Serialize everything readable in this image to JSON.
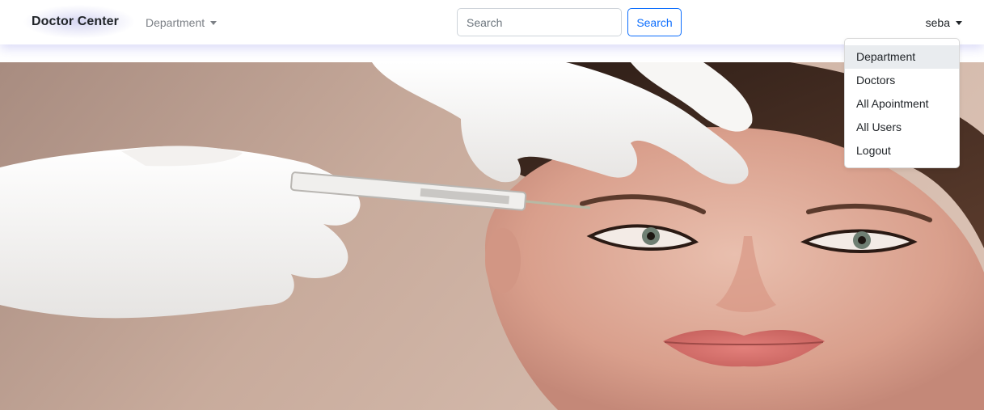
{
  "navbar": {
    "brand": "Doctor Center",
    "department_label": "Department",
    "user_label": "seba"
  },
  "search": {
    "placeholder": "Search",
    "button_label": "Search"
  },
  "user_menu": {
    "items": [
      {
        "label": "Department"
      },
      {
        "label": "Doctors"
      },
      {
        "label": "All Apointment"
      },
      {
        "label": "All Users"
      },
      {
        "label": "Logout"
      }
    ]
  },
  "colors": {
    "primary": "#0d6efd",
    "nav_shadow": "#8c8ce6",
    "hero_background": "#c9ab9b"
  },
  "icons": {
    "dropdown_caret": "caret-down-icon"
  }
}
